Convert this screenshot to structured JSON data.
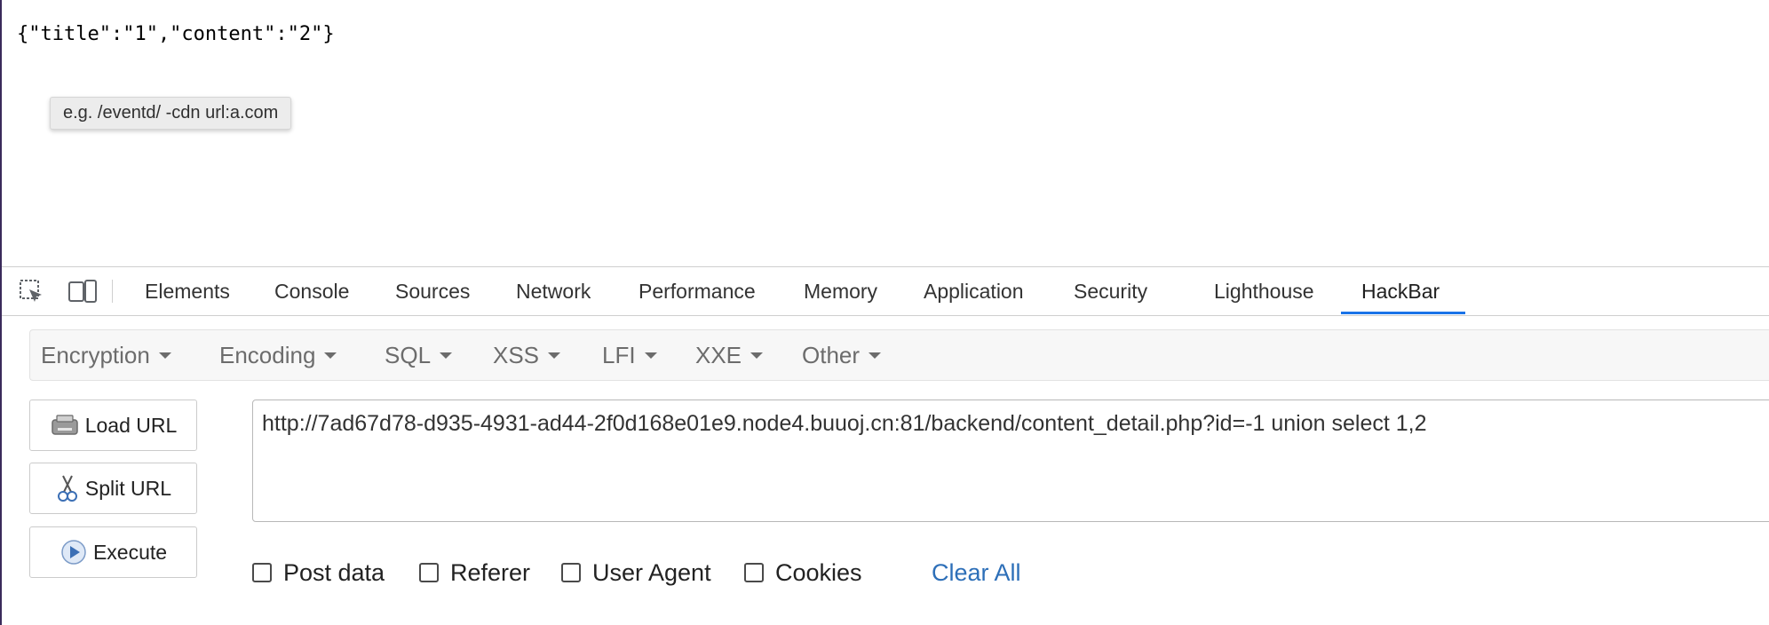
{
  "page": {
    "response_text": "{\"title\":\"1\",\"content\":\"2\"}",
    "tooltip_text": "e.g. /eventd/ -cdn url:a.com"
  },
  "devtools": {
    "tools": [
      "inspect-element-icon",
      "device-toolbar-icon"
    ],
    "tabs": [
      "Elements",
      "Console",
      "Sources",
      "Network",
      "Performance",
      "Memory",
      "Application",
      "Security",
      "Lighthouse",
      "HackBar"
    ],
    "active_tab": "HackBar",
    "accent_color": "#1a73e8"
  },
  "hackbar": {
    "menus": [
      "Encryption",
      "Encoding",
      "SQL",
      "XSS",
      "LFI",
      "XXE",
      "Other"
    ],
    "buttons": {
      "load_url": "Load URL",
      "split_url": "Split URL",
      "execute": "Execute"
    },
    "url": "http://7ad67d78-d935-4931-ad44-2f0d168e01e9.node4.buuoj.cn:81/backend/content_detail.php?id=-1 union select 1,2",
    "options": [
      "Post data",
      "Referer",
      "User Agent",
      "Cookies"
    ],
    "options_checked": [
      false,
      false,
      false,
      false
    ],
    "clear_all": "Clear All",
    "link_color": "#2d6fb8"
  }
}
